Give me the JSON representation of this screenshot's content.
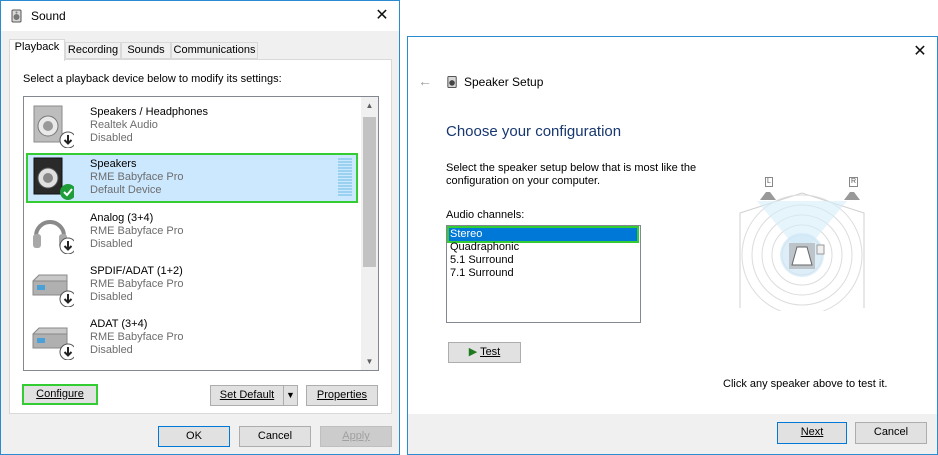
{
  "sound_window": {
    "title": "Sound",
    "tabs": [
      {
        "label": "Playback"
      },
      {
        "label": "Recording"
      },
      {
        "label": "Sounds"
      },
      {
        "label": "Communications"
      }
    ],
    "instruction": "Select a playback device below to modify its settings:",
    "devices": [
      {
        "name": "Speakers / Headphones",
        "driver": "Realtek Audio",
        "status": "Disabled",
        "icon": "speaker-disabled-icon"
      },
      {
        "name": "Speakers",
        "driver": "RME Babyface Pro",
        "status": "Default Device",
        "icon": "speaker-default-icon",
        "selected": true
      },
      {
        "name": "Analog (3+4)",
        "driver": "RME Babyface Pro",
        "status": "Disabled",
        "icon": "headphones-disabled-icon"
      },
      {
        "name": "SPDIF/ADAT (1+2)",
        "driver": "RME Babyface Pro",
        "status": "Disabled",
        "icon": "digital-output-disabled-icon"
      },
      {
        "name": "ADAT (3+4)",
        "driver": "RME Babyface Pro",
        "status": "Disabled",
        "icon": "digital-output-disabled-icon"
      }
    ],
    "buttons": {
      "configure": "Configure",
      "set_default": "Set Default",
      "properties": "Properties",
      "ok": "OK",
      "cancel": "Cancel",
      "apply": "Apply"
    }
  },
  "setup_window": {
    "header": "Speaker Setup",
    "heading": "Choose your configuration",
    "description": "Select the speaker setup below that is most like the configuration on your computer.",
    "channels_label": "Audio channels:",
    "channels": [
      "Stereo",
      "Quadraphonic",
      "5.1 Surround",
      "7.1 Surround"
    ],
    "selected_channel": "Stereo",
    "test_label": "Test",
    "hint": "Click any speaker above to test it.",
    "speaker_labels": {
      "left": "L",
      "right": "R"
    },
    "next_label": "Next",
    "cancel_label": "Cancel"
  },
  "colors": {
    "selection_outline": "#33cc33",
    "selection_bg": "#cce8ff",
    "accent": "#0078d7"
  }
}
